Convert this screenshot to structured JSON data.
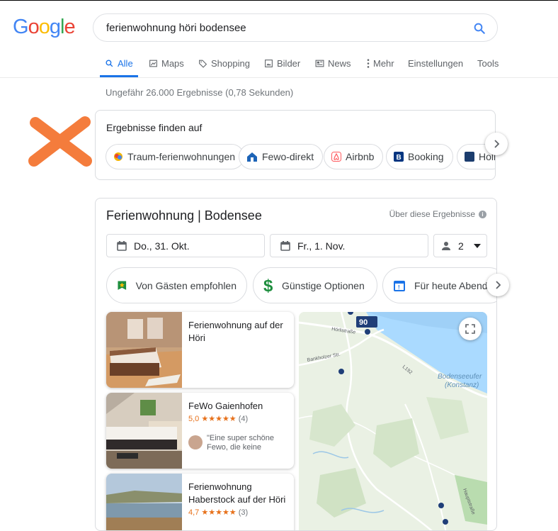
{
  "logo": {
    "letters": [
      "G",
      "o",
      "o",
      "g",
      "l",
      "e"
    ],
    "colors": [
      "#4285f4",
      "#ea4335",
      "#fbbc05",
      "#4285f4",
      "#34a853",
      "#ea4335"
    ]
  },
  "search": {
    "query": "ferienwohnung höri bodensee",
    "icon": "search-icon"
  },
  "tabs": [
    {
      "label": "Alle",
      "icon": "search-icon",
      "active": true
    },
    {
      "label": "Maps",
      "icon": "map-icon"
    },
    {
      "label": "Shopping",
      "icon": "tag-icon"
    },
    {
      "label": "Bilder",
      "icon": "image-icon"
    },
    {
      "label": "News",
      "icon": "news-icon"
    },
    {
      "label": "Mehr",
      "icon": "more-icon"
    },
    {
      "label": "Einstellungen"
    },
    {
      "label": "Tools"
    }
  ],
  "stats": "Ungefähr 26.000 Ergebnisse (0,78 Sekunden)",
  "find_on": {
    "title": "Ergebnisse finden auf",
    "chips": [
      {
        "label": "Traum-ferienwohnungen",
        "color": "#f4b400"
      },
      {
        "label": "Fewo-direkt",
        "color": "#1d64b7"
      },
      {
        "label": "Airbnb",
        "color": "#ff5a5f"
      },
      {
        "label": "Booking",
        "color": "#003580"
      },
      {
        "label": "Holi",
        "color": "#1c3d6e"
      }
    ]
  },
  "hotels": {
    "title": "Ferienwohnung | Bodensee",
    "about": "Über diese Ergebnisse",
    "checkin": "Do., 31. Okt.",
    "checkout": "Fr., 1. Nov.",
    "guests": "2",
    "filters": [
      {
        "label": "Von Gästen empfohlen",
        "icon": "flag-icon"
      },
      {
        "label": "Günstige Optionen",
        "icon": "dollar-icon"
      },
      {
        "label": "Für heute Abend",
        "icon": "calendar-icon"
      }
    ],
    "listings": [
      {
        "name": "Ferienwohnung auf der Höri"
      },
      {
        "name": "FeWo Gaienhofen",
        "rating": "5,0",
        "stars": "★★★★★",
        "reviews": "(4)",
        "review_text": "\"Eine super schöne Fewo, die keine"
      },
      {
        "name": "Ferienwohnung Haberstock auf der Höri",
        "rating": "4,7",
        "stars": "★★★★★",
        "reviews": "(3)"
      }
    ],
    "map": {
      "labels": [
        "Hörlistraße",
        "Bankholzer Str.",
        "L192",
        "Bodenseeufer (Konstanz)",
        "Hauptstraße"
      ],
      "price_pin": "90"
    }
  }
}
